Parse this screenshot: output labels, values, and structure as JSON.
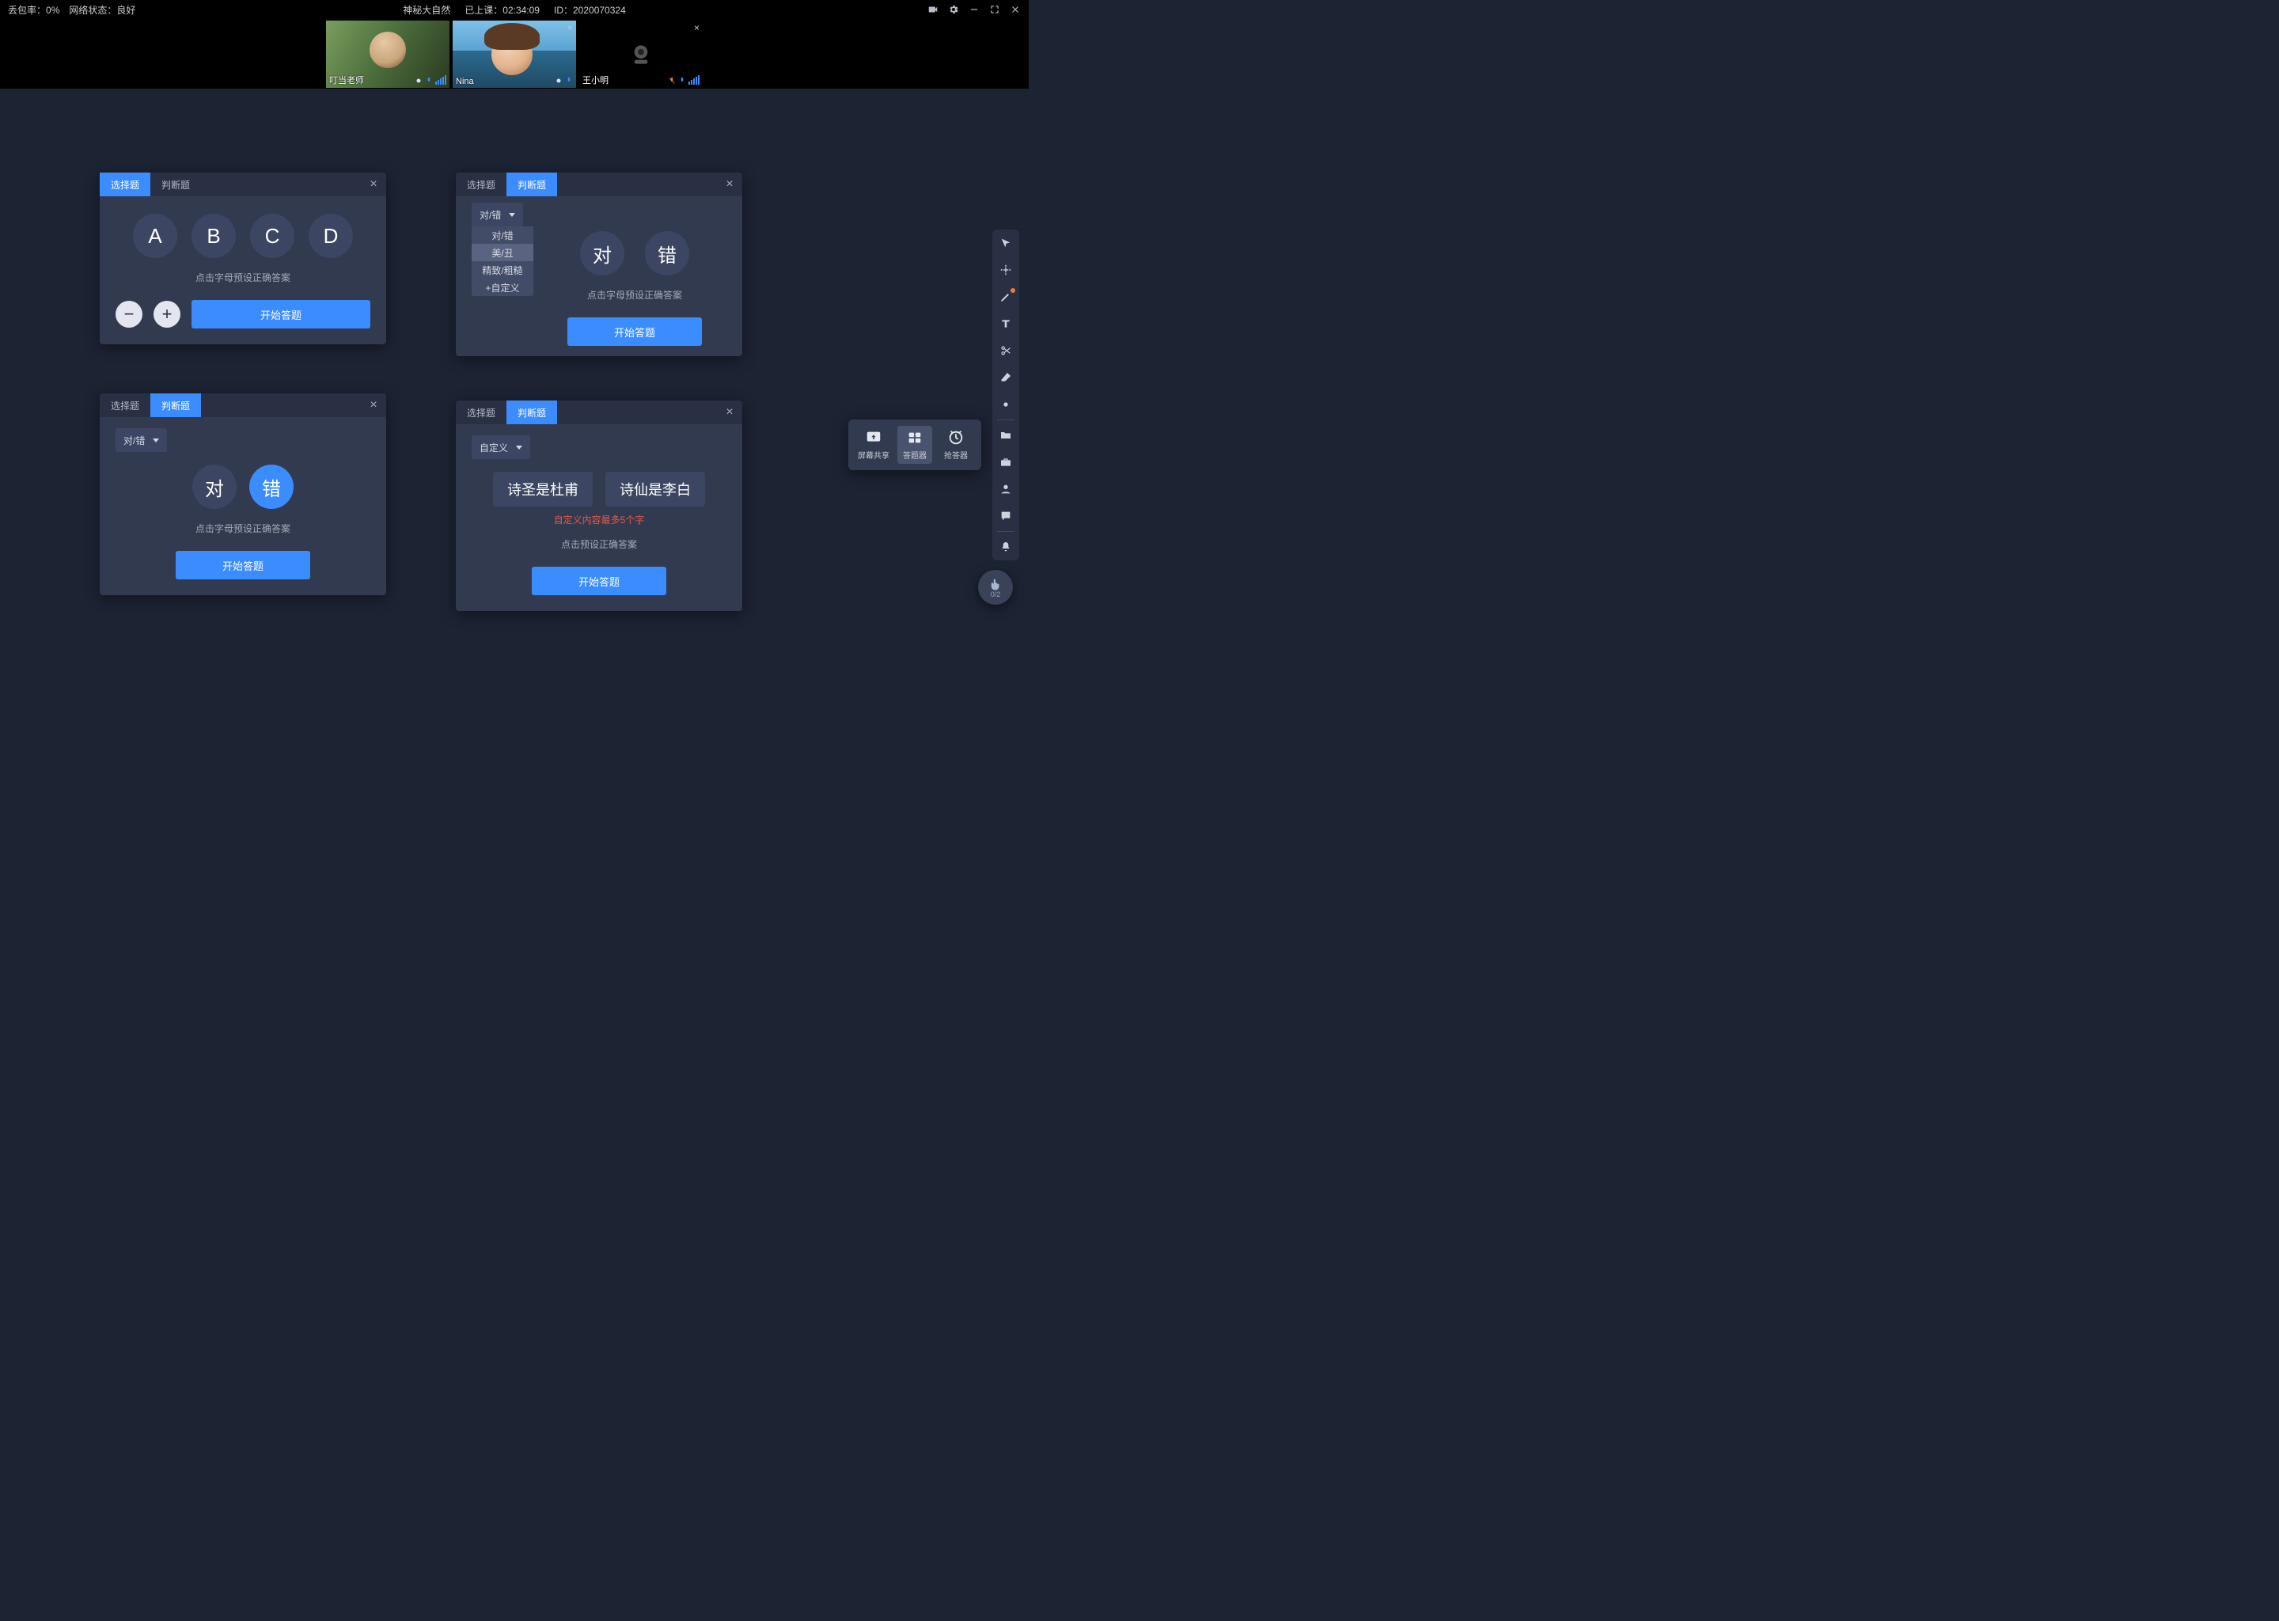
{
  "topbar": {
    "packet_loss_label": "丢包率：",
    "packet_loss_value": "0%",
    "network_label": "网络状态：",
    "network_value": "良好",
    "title": "神秘大自然",
    "elapsed_label": "已上课：",
    "elapsed_value": "02:34:09",
    "id_label": "ID：",
    "id_value": "2020070324"
  },
  "videos": [
    {
      "name": "叮当老师",
      "mic_on": true,
      "cam_on": true
    },
    {
      "name": "Nina",
      "mic_on": true,
      "cam_on": true,
      "closeable": true
    },
    {
      "name": "王小明",
      "mic_on": true,
      "cam_on": false,
      "closeable": true,
      "mic_muted": true
    }
  ],
  "panel1": {
    "tab_choice": "选择题",
    "tab_truefalse": "判断题",
    "options": [
      "A",
      "B",
      "C",
      "D"
    ],
    "hint": "点击字母预设正确答案",
    "minus": "−",
    "plus": "+",
    "start": "开始答题"
  },
  "panel2": {
    "tab_choice": "选择题",
    "tab_truefalse": "判断题",
    "dropdown_value": "对/错",
    "hint": "点击字母预设正确答案",
    "start": "开始答题",
    "opt_true": "对",
    "opt_false": "错",
    "dd_options": [
      "对/错",
      "美/丑",
      "精致/粗糙",
      "+自定义"
    ]
  },
  "panel3": {
    "tab_choice": "选择题",
    "tab_truefalse": "判断题",
    "dropdown_value": "对/错",
    "opt_true": "对",
    "opt_false": "错",
    "hint": "点击字母预设正确答案",
    "start": "开始答题"
  },
  "panel4": {
    "tab_choice": "选择题",
    "tab_truefalse": "判断题",
    "dropdown_value": "自定义",
    "chips": [
      "诗圣是杜甫",
      "诗仙是李白"
    ],
    "warn": "自定义内容最多5个字",
    "hint": "点击预设正确答案",
    "start": "开始答题"
  },
  "tools": {
    "share": "屏幕共享",
    "answer": "答题器",
    "buzzer": "抢答器"
  },
  "fab": {
    "count": "0/2"
  }
}
